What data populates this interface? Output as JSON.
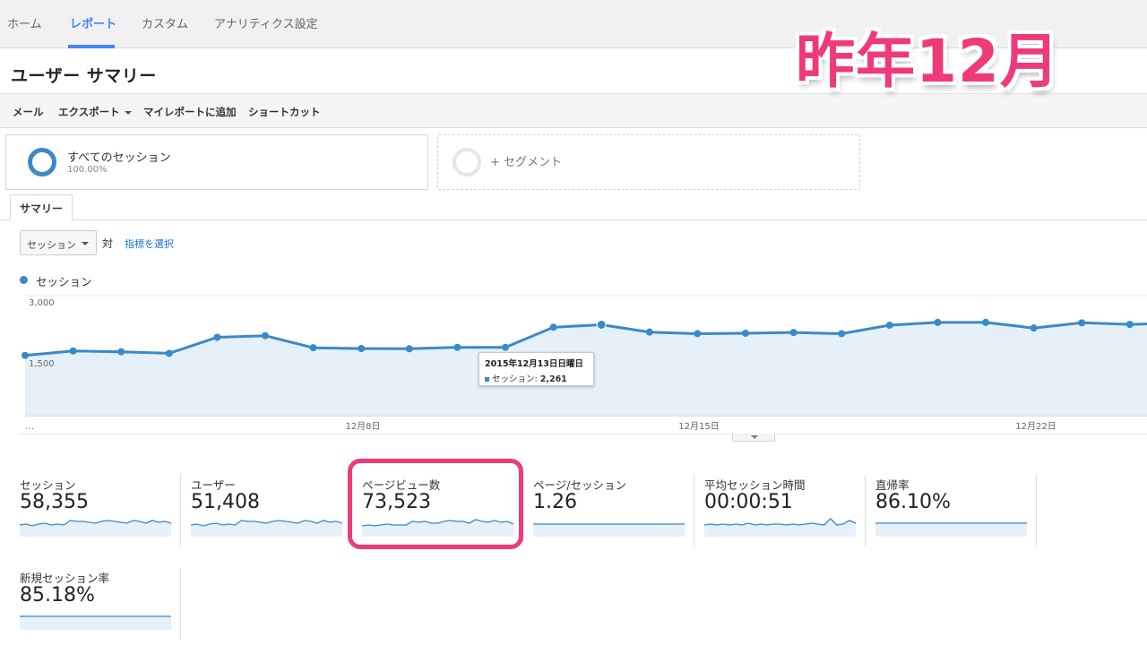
{
  "nav": {
    "tabs": [
      {
        "label": "ホーム",
        "active": false
      },
      {
        "label": "レポート",
        "active": true
      },
      {
        "label": "カスタム",
        "active": false
      },
      {
        "label": "アナリティクス設定",
        "active": false
      }
    ]
  },
  "page_title": "ユーザー サマリー",
  "overlay_title": "昨年12月",
  "toolbar": {
    "mail": "メール",
    "export": "エクスポート",
    "add_to_my_report": "マイレポートに追加",
    "shortcut": "ショートカット"
  },
  "segments": {
    "all": {
      "name": "すべてのセッション",
      "percent": "100.00%"
    },
    "add": {
      "label": "+ セグメント"
    }
  },
  "summary_tab": "サマリー",
  "metric_selector": {
    "value": "セッション",
    "vs": "対",
    "pick_metric": "指標を選択"
  },
  "legend": {
    "label": "セッション"
  },
  "tooltip": {
    "date": "2015年12月13日日曜日",
    "label": "セッション:",
    "value": "2,261"
  },
  "colors": {
    "accent": "#4285f4",
    "series": "#3a8ac6",
    "area": "#e6f0f9",
    "highlight": "#ef3a7a",
    "link": "#1a73c9"
  },
  "chart_data": {
    "type": "area",
    "series": [
      {
        "name": "セッション",
        "values": [
          1500,
          1610,
          1590,
          1550,
          1950,
          1990,
          1690,
          1670,
          1665,
          1700,
          1700,
          2200,
          2261,
          2080,
          2040,
          2050,
          2070,
          2040,
          2250,
          2320,
          2320,
          2180,
          2310,
          2270,
          2300
        ]
      }
    ],
    "y_ticks": [
      "3,000",
      "1,500"
    ],
    "x_ticks": [
      "…",
      "12月8日",
      "12月15日",
      "12月22日"
    ],
    "ylim": [
      0,
      3000
    ],
    "grid": true
  },
  "scorecards": [
    {
      "label": "セッション",
      "value": "58,355",
      "spark": [
        0.5,
        0.55,
        0.45,
        0.55,
        0.6,
        0.5,
        0.55,
        0.5,
        0.75,
        0.7,
        0.7,
        0.65,
        0.6,
        0.7,
        0.75,
        0.7,
        0.65,
        0.6,
        0.75,
        0.7,
        0.6,
        0.75,
        0.65,
        0.7,
        0.6
      ]
    },
    {
      "label": "ユーザー",
      "value": "51,408",
      "spark": [
        0.5,
        0.55,
        0.45,
        0.55,
        0.6,
        0.5,
        0.55,
        0.5,
        0.75,
        0.7,
        0.7,
        0.65,
        0.6,
        0.7,
        0.75,
        0.7,
        0.65,
        0.6,
        0.75,
        0.7,
        0.6,
        0.75,
        0.65,
        0.7,
        0.6
      ]
    },
    {
      "label": "ページビュー数",
      "value": "73,523",
      "spark": [
        0.45,
        0.5,
        0.45,
        0.5,
        0.55,
        0.5,
        0.5,
        0.5,
        0.7,
        0.65,
        0.7,
        0.6,
        0.6,
        0.7,
        0.75,
        0.7,
        0.7,
        0.6,
        0.8,
        0.7,
        0.65,
        0.75,
        0.65,
        0.7,
        0.55
      ]
    },
    {
      "label": "ページ/セッション",
      "value": "1.26",
      "spark": [
        0.55,
        0.55,
        0.55,
        0.55,
        0.55,
        0.55,
        0.55,
        0.55,
        0.55,
        0.55,
        0.55,
        0.55,
        0.55,
        0.55,
        0.55,
        0.55,
        0.55,
        0.55,
        0.55,
        0.55,
        0.55,
        0.55,
        0.55,
        0.55,
        0.55
      ]
    },
    {
      "label": "平均セッション時間",
      "value": "00:00:51",
      "spark": [
        0.5,
        0.55,
        0.5,
        0.55,
        0.5,
        0.55,
        0.5,
        0.6,
        0.5,
        0.55,
        0.5,
        0.55,
        0.55,
        0.5,
        0.55,
        0.5,
        0.55,
        0.6,
        0.55,
        0.5,
        0.85,
        0.5,
        0.55,
        0.75,
        0.6
      ]
    },
    {
      "label": "直帰率",
      "value": "86.10%",
      "spark": [
        0.6,
        0.6,
        0.6,
        0.6,
        0.6,
        0.6,
        0.6,
        0.6,
        0.6,
        0.6,
        0.6,
        0.6,
        0.6,
        0.6,
        0.6,
        0.6,
        0.6,
        0.6,
        0.6,
        0.6,
        0.6,
        0.6,
        0.6,
        0.6,
        0.6
      ]
    },
    {
      "label": "新規セッション率",
      "value": "85.18%",
      "spark": [
        0.6,
        0.6,
        0.6,
        0.6,
        0.6,
        0.6,
        0.6,
        0.6,
        0.6,
        0.6,
        0.6,
        0.6,
        0.6,
        0.6,
        0.6,
        0.6,
        0.6,
        0.6,
        0.6,
        0.6,
        0.6,
        0.6,
        0.6,
        0.6,
        0.6
      ]
    }
  ]
}
